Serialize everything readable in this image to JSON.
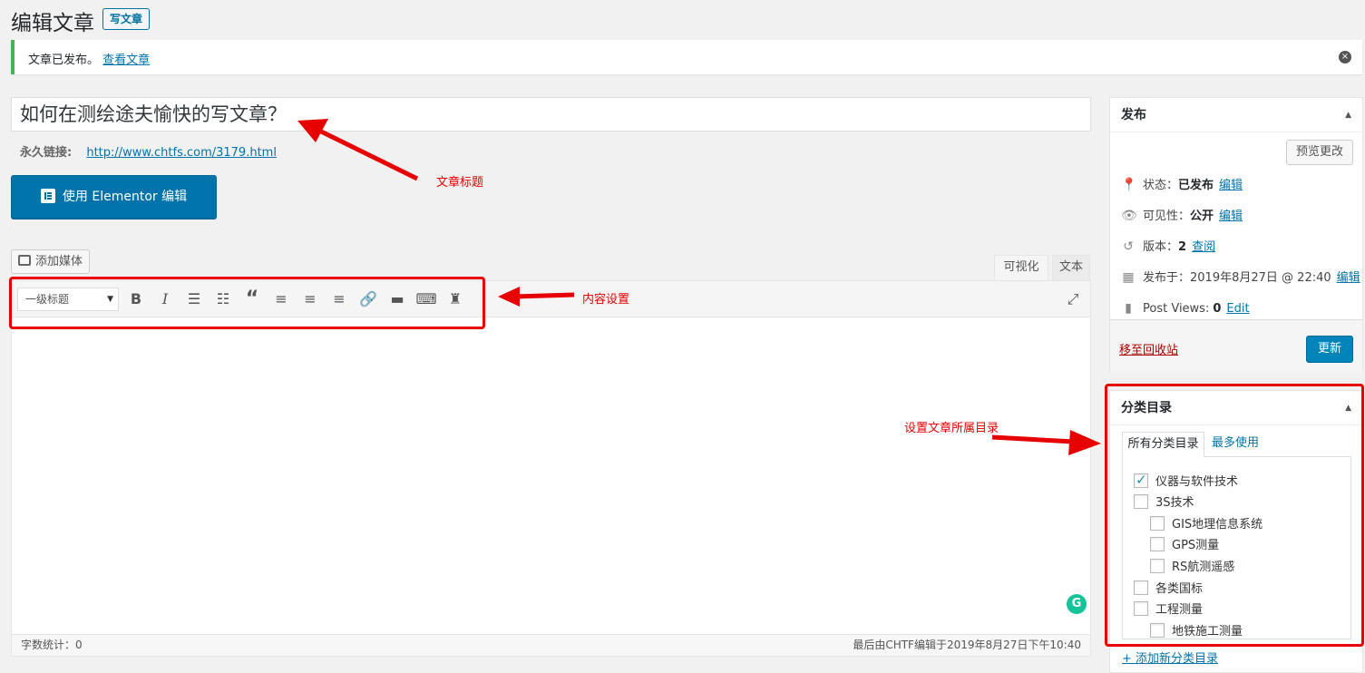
{
  "header": {
    "title": "编辑文章",
    "new_post": "写文章"
  },
  "notice": {
    "text": "文章已发布。",
    "link": "查看文章",
    "close": "×"
  },
  "post": {
    "title": "如何在测绘途夫愉快的写文章？",
    "permalink_label": "永久链接:",
    "permalink_url": "http://www.chtfs.com/3179.html"
  },
  "elementor_button": "使用 Elementor 编辑",
  "editor": {
    "add_media": "添加媒体",
    "tab_visual": "可视化",
    "tab_text": "文本",
    "format_select": "一级标题",
    "word_count": "字数统计：0",
    "last_edited": "最后由CHTF编辑于2019年8月27日下午10:40"
  },
  "annotations": {
    "title_note": "文章标题",
    "content_note": "内容设置",
    "category_note": "设置文章所属目录"
  },
  "publish": {
    "heading": "发布",
    "preview": "预览更改",
    "status_label": "状态：",
    "status_value": "已发布",
    "visibility_label": "可见性：",
    "visibility_value": "公开",
    "revisions_label": "版本：",
    "revisions_value": "2",
    "revisions_link": "查阅",
    "published_label": "发布于：",
    "published_value": "2019年8月27日 @ 22:40",
    "views_label": "Post Views:",
    "views_value": "0",
    "views_link": "Edit",
    "edit_link": "编辑",
    "trash": "移至回收站",
    "update": "更新"
  },
  "categories": {
    "heading": "分类目录",
    "tab_all": "所有分类目录",
    "tab_popular": "最多使用",
    "items": [
      {
        "label": "仪器与软件技术",
        "checked": true,
        "level": 0
      },
      {
        "label": "3S技术",
        "checked": false,
        "level": 0
      },
      {
        "label": "GIS地理信息系统",
        "checked": false,
        "level": 1
      },
      {
        "label": "GPS测量",
        "checked": false,
        "level": 1
      },
      {
        "label": "RS航测遥感",
        "checked": false,
        "level": 1
      },
      {
        "label": "各类国标",
        "checked": false,
        "level": 0
      },
      {
        "label": "工程测量",
        "checked": false,
        "level": 0
      },
      {
        "label": "地铁施工测量",
        "checked": false,
        "level": 1
      }
    ],
    "add_new": "+ 添加新分类目录"
  },
  "colors": {
    "accent": "#0073aa",
    "annotation": "#e60000",
    "success": "#46b450"
  }
}
